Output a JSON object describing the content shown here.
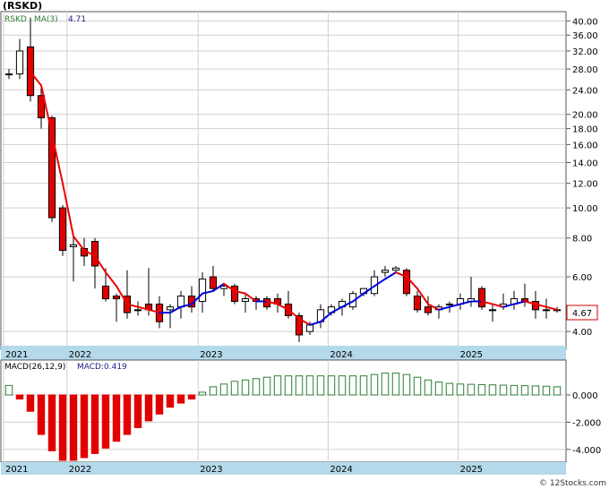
{
  "header": {
    "title": "(RSKD)"
  },
  "legend": {
    "ticker": "RSKD",
    "ma_label": "MA(3)",
    "ma_value": "4.71"
  },
  "macd_legend": {
    "label": "MACD(26,12,9)",
    "value_label": "MACD:0.419"
  },
  "last_price": "4.67",
  "credit": "© 12Stocks.com",
  "colors": {
    "up": "#ffffff",
    "down": "#e00000",
    "candle_edge": "#000000",
    "ma_up": "#0000dd",
    "ma_down": "#ee0000",
    "macd_pos": "#2e7d32",
    "macd_neg": "#e00000",
    "axis_band": "#b4d9ea"
  },
  "chart_data": [
    {
      "type": "candlestick",
      "title": "(RSKD)",
      "scale": "log",
      "ylim": [
        3.6,
        42
      ],
      "y_ticks": [
        40,
        36,
        32,
        28,
        24,
        20,
        18,
        16,
        14,
        12,
        10,
        8,
        6,
        4
      ],
      "y_tick_labels": [
        "40.00",
        "36.00",
        "32.00",
        "28.00",
        "24.00",
        "20.00",
        "18.00",
        "16.00",
        "14.00",
        "12.00",
        "10.00",
        "8.00",
        "6.00",
        "4.00"
      ],
      "x_labels": [
        {
          "label": "2021",
          "x": 0
        },
        {
          "label": "2022",
          "x": 5.9
        },
        {
          "label": "2023",
          "x": 18.1
        },
        {
          "label": "2024",
          "x": 30.2
        },
        {
          "label": "2025",
          "x": 42.3
        }
      ],
      "series": [
        {
          "name": "RSKD",
          "ohlc": [
            [
              27,
              28,
              26,
              27
            ],
            [
              27,
              35,
              26,
              32
            ],
            [
              33,
              41,
              22,
              23
            ],
            [
              23,
              25,
              18,
              19.5
            ],
            [
              19.5,
              19.8,
              9,
              9.3
            ],
            [
              10,
              10.2,
              7,
              7.3
            ],
            [
              7.5,
              8.3,
              5.8,
              7.6
            ],
            [
              7.4,
              8,
              6.5,
              7
            ],
            [
              7.8,
              8,
              5.5,
              6.5
            ],
            [
              5.6,
              6.4,
              5,
              5.1
            ],
            [
              5.2,
              5.3,
              4.3,
              5.1
            ],
            [
              5.2,
              6.3,
              4.4,
              4.6
            ],
            [
              4.7,
              5,
              4.5,
              4.7
            ],
            [
              4.9,
              6.4,
              4.5,
              4.7
            ],
            [
              4.9,
              5.2,
              4.1,
              4.3
            ],
            [
              4.7,
              4.9,
              4.1,
              4.8
            ],
            [
              4.8,
              5.4,
              4.4,
              5.2
            ],
            [
              5.2,
              5.6,
              4.6,
              4.8
            ],
            [
              5,
              6.2,
              4.6,
              5.9
            ],
            [
              6,
              6.5,
              5.4,
              5.5
            ],
            [
              5.5,
              5.7,
              5.2,
              5.6
            ],
            [
              5.6,
              5.7,
              4.9,
              5
            ],
            [
              5,
              5.3,
              4.6,
              5.1
            ],
            [
              5.1,
              5.2,
              4.7,
              5
            ],
            [
              5.1,
              5.2,
              4.7,
              4.8
            ],
            [
              5.1,
              5.3,
              4.6,
              4.9
            ],
            [
              4.9,
              5.4,
              4.4,
              4.5
            ],
            [
              4.5,
              4.6,
              3.7,
              3.9
            ],
            [
              4.0,
              4.3,
              3.9,
              4.2
            ],
            [
              4.3,
              4.9,
              4.1,
              4.7
            ],
            [
              4.6,
              4.9,
              4.5,
              4.8
            ],
            [
              4.8,
              5.1,
              4.5,
              5
            ],
            [
              4.8,
              5.4,
              4.7,
              5.3
            ],
            [
              5.3,
              5.5,
              5.2,
              5.5
            ],
            [
              5.3,
              6.3,
              5.2,
              6.0
            ],
            [
              6.2,
              6.5,
              6.0,
              6.3
            ],
            [
              6.3,
              6.5,
              6.2,
              6.4
            ],
            [
              6.3,
              6.4,
              5.2,
              5.3
            ],
            [
              5.2,
              5.4,
              4.6,
              4.7
            ],
            [
              4.8,
              5.2,
              4.5,
              4.6
            ],
            [
              4.7,
              4.9,
              4.4,
              4.8
            ],
            [
              4.9,
              5.0,
              4.6,
              4.9
            ],
            [
              4.9,
              5.3,
              4.7,
              5.1
            ],
            [
              5.0,
              6.0,
              4.8,
              5.1
            ],
            [
              5.5,
              5.6,
              4.7,
              4.8
            ],
            [
              4.7,
              4.9,
              4.3,
              4.7
            ],
            [
              4.8,
              5.3,
              4.7,
              4.9
            ],
            [
              4.9,
              5.4,
              4.7,
              5.1
            ],
            [
              5.1,
              5.7,
              4.8,
              5.0
            ],
            [
              5.0,
              5.4,
              4.4,
              4.7
            ],
            [
              4.7,
              5.1,
              4.4,
              4.7
            ],
            [
              4.7,
              4.8,
              4.6,
              4.7
            ]
          ]
        },
        {
          "name": "MA(3)",
          "values": [
            null,
            null,
            27.4,
            24.8,
            17.3,
            12.0,
            8.1,
            7.3,
            7.0,
            6.2,
            5.6,
            4.9,
            4.8,
            4.7,
            4.6,
            4.6,
            4.8,
            4.9,
            5.3,
            5.4,
            5.7,
            5.4,
            5.3,
            5.0,
            5.0,
            4.9,
            4.7,
            4.4,
            4.2,
            4.3,
            4.6,
            4.8,
            5.0,
            5.3,
            5.6,
            5.9,
            6.2,
            6.0,
            5.5,
            4.9,
            4.7,
            4.8,
            4.9,
            5.0,
            5.0,
            4.9,
            4.8,
            4.9,
            5.0,
            4.9,
            4.8,
            4.7
          ]
        }
      ]
    },
    {
      "type": "bar",
      "title": "MACD(26,12,9)",
      "ylim": [
        -4800,
        2300
      ],
      "y_ticks": [
        0,
        -2000,
        -4000
      ],
      "y_tick_labels": [
        "0.000",
        "-2.000",
        "-4.000"
      ],
      "x_labels": [
        {
          "label": "2021",
          "x": 0
        },
        {
          "label": "2022",
          "x": 5.9
        },
        {
          "label": "2023",
          "x": 18.1
        },
        {
          "label": "2024",
          "x": 30.2
        },
        {
          "label": "2025",
          "x": 42.3
        }
      ],
      "values": [
        700,
        -300,
        -1200,
        -2900,
        -4100,
        -4800,
        -4800,
        -4600,
        -4300,
        -3900,
        -3400,
        -2900,
        -2400,
        -1900,
        -1400,
        -900,
        -600,
        -300,
        200,
        600,
        800,
        1000,
        1100,
        1200,
        1300,
        1400,
        1400,
        1400,
        1400,
        1400,
        1400,
        1400,
        1400,
        1400,
        1500,
        1600,
        1600,
        1500,
        1300,
        1100,
        950,
        850,
        800,
        780,
        760,
        740,
        720,
        700,
        680,
        660,
        640,
        600
      ]
    }
  ]
}
